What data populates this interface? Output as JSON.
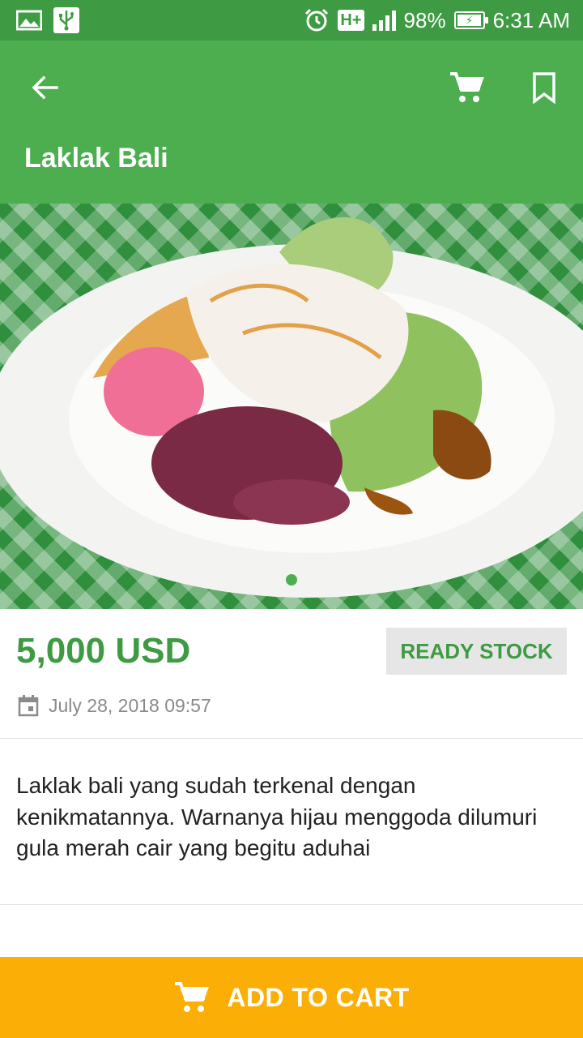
{
  "status_bar": {
    "network": "H+",
    "battery": "98%",
    "battery_level": 0.98,
    "time": "6:31 AM"
  },
  "header": {
    "title": "Laklak Bali",
    "icons": [
      "back-arrow-icon",
      "cart-icon",
      "bookmark-icon"
    ]
  },
  "gallery": {
    "page_count": 1,
    "current_page": 1
  },
  "product": {
    "price": "5,000 USD",
    "stock_label": "READY STOCK",
    "date": "July 28, 2018 09:57",
    "description": "Laklak bali yang sudah terkenal dengan kenikmatannya. Warnanya hijau menggoda dilumuri gula merah cair yang begitu aduhai"
  },
  "footer": {
    "add_to_cart_label": "ADD TO CART"
  },
  "colors": {
    "status_bar": "#3e9b43",
    "app_bar": "#4cae4f",
    "accent": "#3e9b43",
    "button": "#fbaf06"
  }
}
